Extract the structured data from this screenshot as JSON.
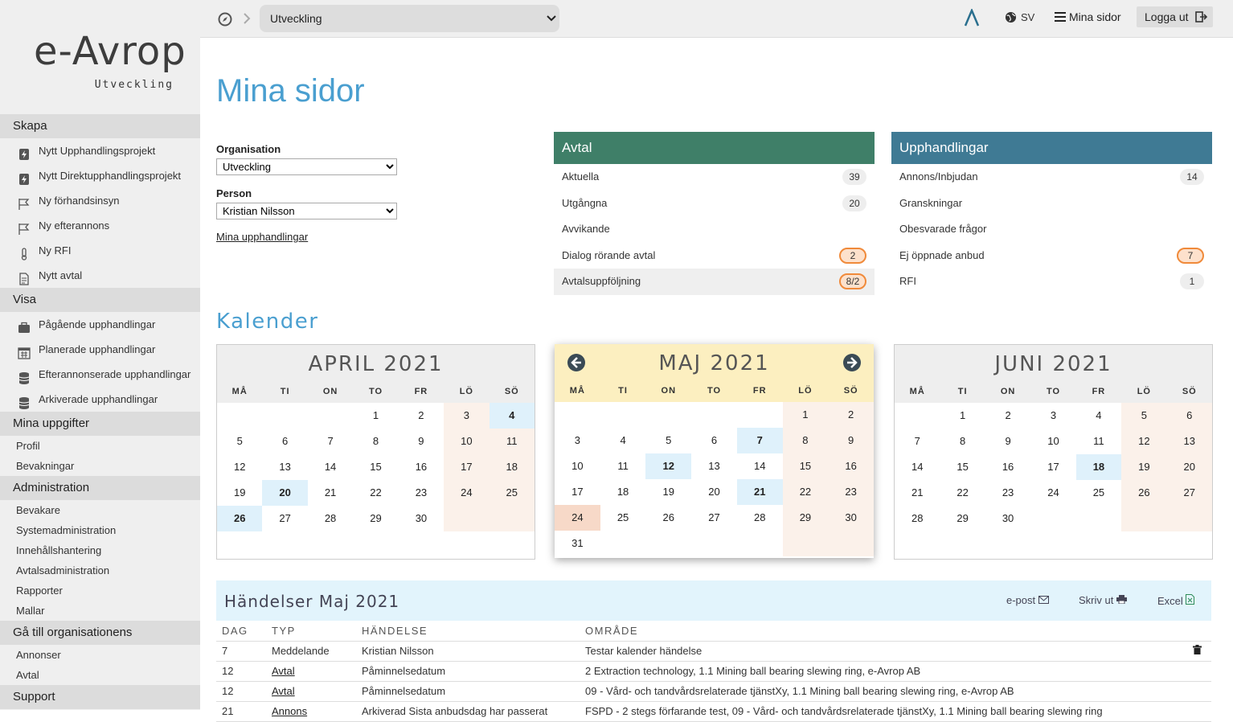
{
  "logo": {
    "brand": "e-Avrop",
    "env": "Utveckling"
  },
  "sidebar": {
    "sections": [
      {
        "title": "Skapa",
        "items": [
          "Nytt Upphandlingsprojekt",
          "Nytt Direktupphandlingsprojekt",
          "Ny förhandsinsyn",
          "Ny efterannons",
          "Ny RFI",
          "Nytt avtal"
        ]
      },
      {
        "title": "Visa",
        "items": [
          "Pågående upphandlingar",
          "Planerade upphandlingar",
          "Efterannonserade upphandlingar",
          "Arkiverade upphandlingar"
        ]
      },
      {
        "title": "Mina uppgifter",
        "items": [
          "Profil",
          "Bevakningar"
        ]
      },
      {
        "title": "Administration",
        "items": [
          "Bevakare",
          "Systemadministration",
          "Innehållshantering",
          "Avtalsadministration",
          "Rapporter",
          "Mallar"
        ]
      },
      {
        "title": "Gå till organisationens",
        "items": [
          "Annonser",
          "Avtal"
        ]
      },
      {
        "title": "Support",
        "items": []
      }
    ]
  },
  "topbar": {
    "org_select": "Utveckling",
    "lang": "SV",
    "my_pages": "Mina sidor",
    "logout": "Logga ut"
  },
  "main": {
    "title": "Mina sidor",
    "org_label": "Organisation",
    "org_value": "Utveckling",
    "person_label": "Person",
    "person_value": "Kristian Nilsson",
    "my_link": "Mina upphandlingar",
    "calendar_title": "Kalender"
  },
  "avtal": {
    "title": "Avtal",
    "color": "#3f7f68",
    "rows": [
      {
        "label": "Aktuella",
        "count": "39"
      },
      {
        "label": "Utgångna",
        "count": "20"
      },
      {
        "label": "Avvikande",
        "count": ""
      },
      {
        "label": "Dialog rörande avtal",
        "count": "2"
      },
      {
        "label": "Avtalsuppföljning",
        "count": "8/2"
      }
    ]
  },
  "upph": {
    "title": "Upphandlingar",
    "color": "#3f7a94",
    "rows": [
      {
        "label": "Annons/Inbjudan",
        "count": "14"
      },
      {
        "label": "Granskningar",
        "count": ""
      },
      {
        "label": "Obesvarade frågor",
        "count": ""
      },
      {
        "label": "Ej öppnade anbud",
        "count": "7"
      },
      {
        "label": "RFI",
        "count": "1"
      }
    ]
  },
  "weekdays": [
    "MÅ",
    "TI",
    "ON",
    "TO",
    "FR",
    "LÖ",
    "SÖ"
  ],
  "calendars": [
    {
      "title": "APRIL 2021",
      "offset": 3,
      "days": 30,
      "highlight": [
        4,
        20,
        26
      ],
      "special": []
    },
    {
      "title": "MAJ 2021",
      "offset": 5,
      "days": 31,
      "highlight": [
        7,
        12,
        21
      ],
      "special": [
        24
      ]
    },
    {
      "title": "JUNI 2021",
      "offset": 1,
      "days": 30,
      "highlight": [
        18
      ],
      "special": []
    }
  ],
  "events": {
    "title": "Händelser Maj 2021",
    "email": "e-post",
    "print": "Skriv ut",
    "excel": "Excel",
    "columns": [
      "DAG",
      "TYP",
      "HÄNDELSE",
      "OMRÅDE"
    ],
    "rows": [
      {
        "day": "7",
        "type": "Meddelande",
        "event": "Kristian Nilsson",
        "area": "Testar kalender händelse",
        "link": false
      },
      {
        "day": "12",
        "type": "Avtal",
        "event": "Påminnelsedatum",
        "area": "2 Extraction technology, 1.1 Mining ball bearing slewing ring, e-Avrop AB",
        "link": true
      },
      {
        "day": "12",
        "type": "Avtal",
        "event": "Påminnelsedatum",
        "area": "09 - Vård- och tandvårdsrelaterade tjänstXy, 1.1 Mining ball bearing slewing ring, e-Avrop AB",
        "link": true
      },
      {
        "day": "21",
        "type": "Annons",
        "event": "Arkiverad Sista anbudsdag har passerat",
        "area": "FSPD - 2 stegs förfarande test, 09 - Vård- och tandvårdsrelaterade tjänstXy, 1.1 Mining ball bearing slewing ring",
        "link": true
      }
    ]
  }
}
